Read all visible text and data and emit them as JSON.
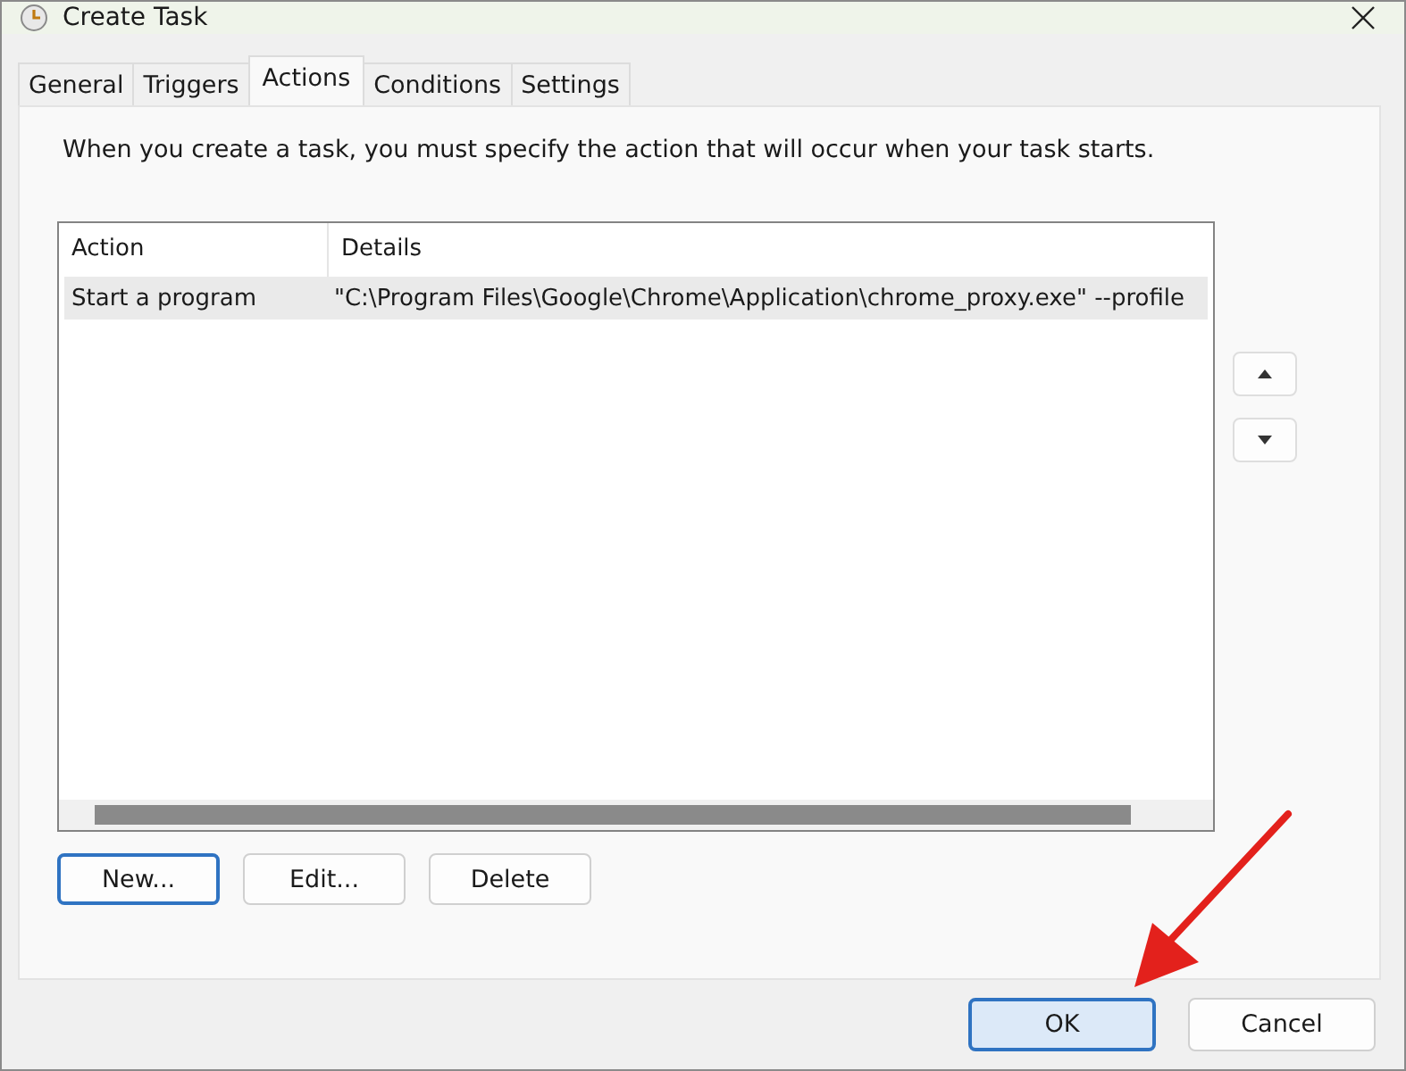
{
  "window": {
    "title": "Create Task"
  },
  "tabs": [
    {
      "label": "General",
      "selected": false
    },
    {
      "label": "Triggers",
      "selected": false
    },
    {
      "label": "Actions",
      "selected": true
    },
    {
      "label": "Conditions",
      "selected": false
    },
    {
      "label": "Settings",
      "selected": false
    }
  ],
  "description": "When you create a task, you must specify the action that will occur when your task starts.",
  "table": {
    "columns": [
      "Action",
      "Details"
    ],
    "rows": [
      {
        "action": "Start a program",
        "details": "\"C:\\Program Files\\Google\\Chrome\\Application\\chrome_proxy.exe\"   --profile",
        "selected": true
      }
    ]
  },
  "action_buttons": [
    {
      "label": "New...",
      "focused": true
    },
    {
      "label": "Edit...",
      "focused": false
    },
    {
      "label": "Delete",
      "focused": false
    }
  ],
  "dialog_buttons": [
    {
      "label": "OK",
      "default": true
    },
    {
      "label": "Cancel",
      "default": false
    }
  ]
}
